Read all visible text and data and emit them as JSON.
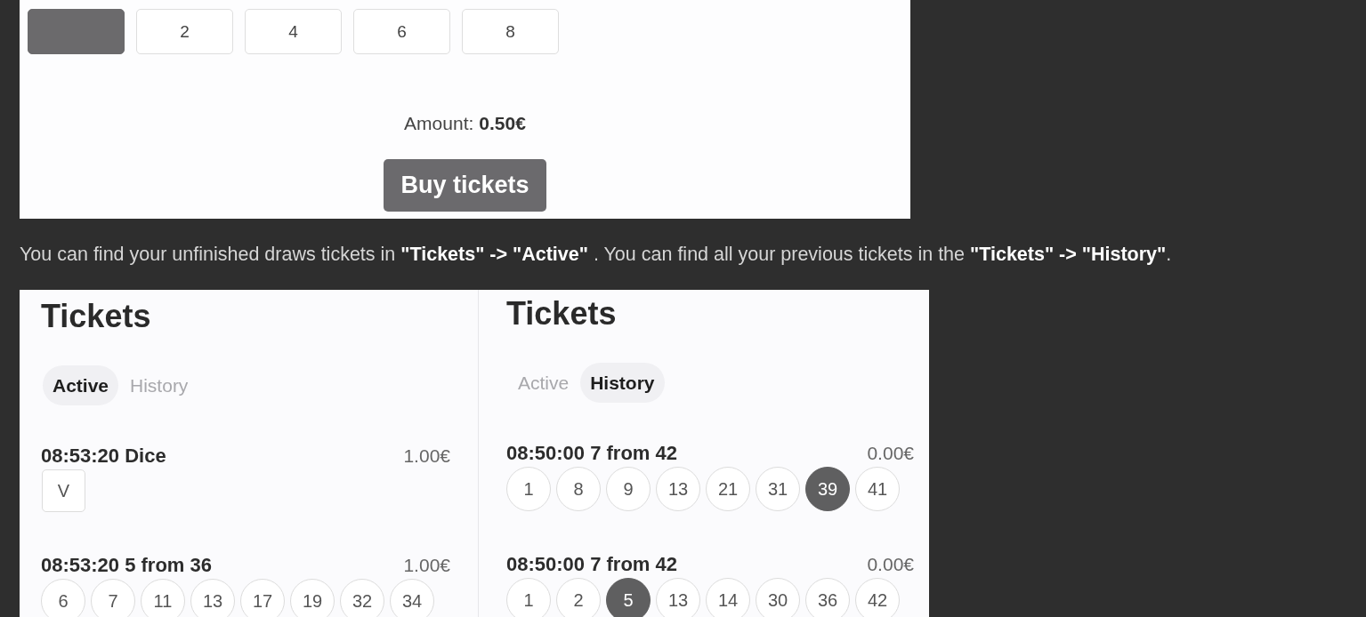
{
  "bet_panel": {
    "options": [
      {
        "selected": true
      },
      {
        "label": "2",
        "selected": false
      },
      {
        "label": "4",
        "selected": false
      },
      {
        "label": "6",
        "selected": false
      },
      {
        "label": "8",
        "selected": false
      }
    ],
    "amount": {
      "label": "Amount:",
      "value": "0.50€"
    },
    "buy_button": "Buy tickets"
  },
  "note": "You can find your unfinished draws tickets in **\"Tickets\" -> \"Active\"** . You can find all your previous tickets in the **\"Tickets\" -> \"History\"**.",
  "ticket_panels": [
    {
      "title": "Tickets",
      "tabs": [
        {
          "label": "Active",
          "selected": true
        },
        {
          "label": "History",
          "selected": false
        }
      ],
      "tickets": [
        {
          "kind": "dice",
          "title": "08:53:20 Dice",
          "amount": "1.00€",
          "picks": [
            {
              "label": "V",
              "highlighted": false
            }
          ]
        },
        {
          "kind": "numbers",
          "title": "08:53:20 5 from 36",
          "amount": "1.00€",
          "picks": [
            {
              "label": "6",
              "highlighted": false
            },
            {
              "label": "7",
              "highlighted": false
            },
            {
              "label": "11",
              "highlighted": false
            },
            {
              "label": "13",
              "highlighted": false
            },
            {
              "label": "17",
              "highlighted": false
            },
            {
              "label": "19",
              "highlighted": false
            },
            {
              "label": "32",
              "highlighted": false
            },
            {
              "label": "34",
              "highlighted": false
            }
          ]
        }
      ]
    },
    {
      "title": "Tickets",
      "tabs": [
        {
          "label": "Active",
          "selected": false
        },
        {
          "label": "History",
          "selected": true
        }
      ],
      "tickets": [
        {
          "kind": "numbers",
          "title": "08:50:00 7 from 42",
          "amount": "0.00€",
          "picks": [
            {
              "label": "1",
              "highlighted": false
            },
            {
              "label": "8",
              "highlighted": false
            },
            {
              "label": "9",
              "highlighted": false
            },
            {
              "label": "13",
              "highlighted": false
            },
            {
              "label": "21",
              "highlighted": false
            },
            {
              "label": "31",
              "highlighted": false
            },
            {
              "label": "39",
              "highlighted": true
            },
            {
              "label": "41",
              "highlighted": false
            }
          ]
        },
        {
          "kind": "numbers",
          "title": "08:50:00 7 from 42",
          "amount": "0.00€",
          "picks": [
            {
              "label": "1",
              "highlighted": false
            },
            {
              "label": "2",
              "highlighted": false
            },
            {
              "label": "5",
              "highlighted": true
            },
            {
              "label": "13",
              "highlighted": false
            },
            {
              "label": "14",
              "highlighted": false
            },
            {
              "label": "30",
              "highlighted": false
            },
            {
              "label": "36",
              "highlighted": false
            },
            {
              "label": "42",
              "highlighted": false
            }
          ]
        }
      ]
    }
  ]
}
